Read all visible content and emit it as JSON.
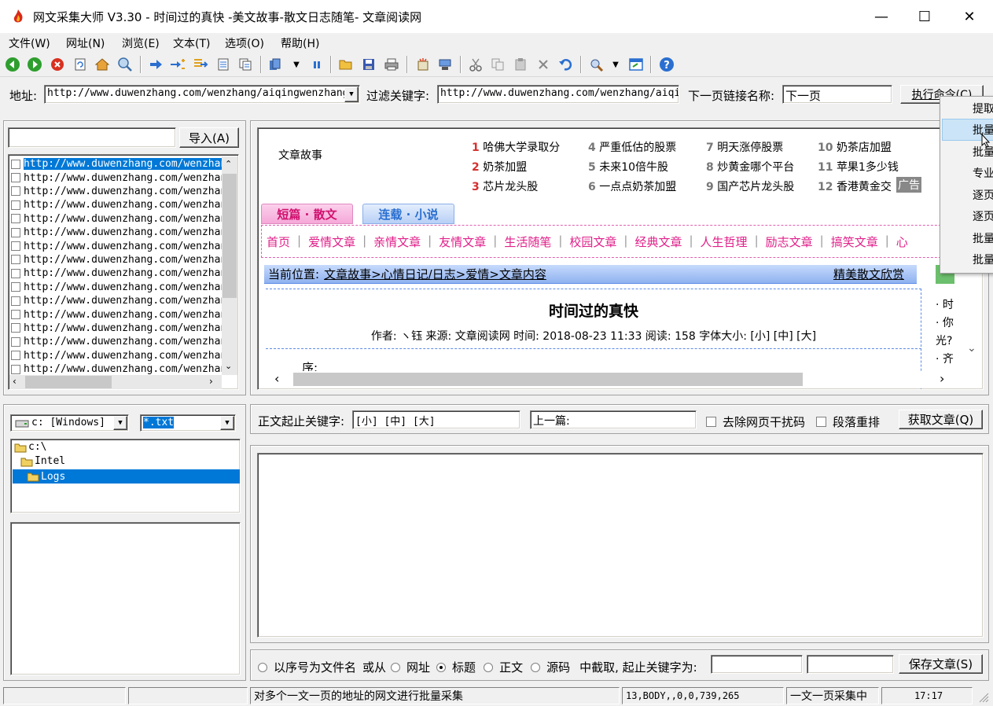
{
  "window": {
    "title": "网文采集大师 V3.30 - 时间过的真快 -美文故事-散文日志随笔- 文章阅读网",
    "minimize": "—",
    "maximize": "☐",
    "close": "✕"
  },
  "menu": [
    "文件(W)",
    "网址(N)",
    "浏览(E)",
    "文本(T)",
    "选项(O)",
    "帮助(H)"
  ],
  "address": {
    "label": "地址:",
    "value": "http://www.duwenzhang.com/wenzhang/aiqingwenzhang/",
    "filter_label": "过滤关键字:",
    "filter_value": "http://www.duwenzhang.com/wenzhang/aiqing",
    "next_label": "下一页链接名称:",
    "next_value": "下一页",
    "execute_button": "执行命令(C)"
  },
  "url_panel": {
    "import_button": "导入(A)",
    "search_value": "",
    "urls": [
      "http://www.duwenzhang.com/wenzhang",
      "http://www.duwenzhang.com/wenzhang",
      "http://www.duwenzhang.com/wenzhang",
      "http://www.duwenzhang.com/wenzhang",
      "http://www.duwenzhang.com/wenzhang",
      "http://www.duwenzhang.com/wenzhang",
      "http://www.duwenzhang.com/wenzhang",
      "http://www.duwenzhang.com/wenzhang",
      "http://www.duwenzhang.com/wenzhang",
      "http://www.duwenzhang.com/wenzhang",
      "http://www.duwenzhang.com/wenzhang",
      "http://www.duwenzhang.com/wenzhang",
      "http://www.duwenzhang.com/wenzhang",
      "http://www.duwenzhang.com/wenzhang",
      "http://www.duwenzhang.com/wenzhang",
      "http://www.duwenzhang.com/wenzhang"
    ]
  },
  "browser": {
    "site_label": "文章故事",
    "hot": [
      {
        "n": "1",
        "t": "哈佛大学录取分"
      },
      {
        "n": "2",
        "t": "奶茶加盟"
      },
      {
        "n": "3",
        "t": "芯片龙头股"
      },
      {
        "n": "4",
        "t": "严重低估的股票"
      },
      {
        "n": "5",
        "t": "未来10倍牛股"
      },
      {
        "n": "6",
        "t": "一点点奶茶加盟"
      },
      {
        "n": "7",
        "t": "明天涨停股票"
      },
      {
        "n": "8",
        "t": "炒黄金哪个平台"
      },
      {
        "n": "9",
        "t": "国产芯片龙头股"
      },
      {
        "n": "10",
        "t": "奶茶店加盟"
      },
      {
        "n": "11",
        "t": "苹果1多少钱"
      },
      {
        "n": "12",
        "t": "香港黄金交"
      }
    ],
    "ad": "广告",
    "tab1": "短篇 · 散文",
    "tab2": "连载 · 小说",
    "nav": [
      "首页",
      "|",
      "爱情文章",
      "|",
      "亲情文章",
      "|",
      "友情文章",
      "|",
      "生活随笔",
      "|",
      "校园文章",
      "|",
      "经典文章",
      "|",
      "人生哲理",
      "|",
      "励志文章",
      "|",
      "搞笑文章",
      "|",
      "心"
    ],
    "breadcrumb_prefix": "当前位置:",
    "breadcrumb": "文章故事>心情日记/日志>爱情>文章内容",
    "breadcrumb_right": "精美散文欣赏",
    "article_title": "时间过的真快",
    "meta": "作者: ヽ钰 来源: 文章阅读网 时间: 2018-08-23 11:33 阅读: 158 字体大小: [小] [中] [大]",
    "body_start": "序:",
    "side_items": [
      "· 时",
      "· 你",
      "光?",
      "· 齐"
    ]
  },
  "extract_row": {
    "start_label": "正文起止关键字:",
    "start_value": "[小] [中] [大]",
    "prev_value": "上一篇:",
    "remove_interference": "去除网页干扰码",
    "reorder_paragraphs": "段落重排",
    "fetch_button": "获取文章(Q)"
  },
  "drive": {
    "drive_value": "c: [Windows]",
    "filter_value": "*.txt",
    "tree": [
      "c:\\",
      "Intel",
      "Logs"
    ]
  },
  "save_row": {
    "opt_seq": "以序号为文件名",
    "or_from": "或从",
    "opt_url": "网址",
    "opt_title": "标题",
    "opt_body": "正文",
    "opt_source": "源码",
    "extract_label": "中截取, 起止关键字为:",
    "key1": "",
    "key2": "⁣",
    "save_button": "保存文章(S)"
  },
  "popup": [
    "提取",
    "批量",
    "批量",
    "专业",
    "逐页",
    "逐页",
    "批量",
    "批量"
  ],
  "status": {
    "s1": "",
    "s2": "",
    "message": "对多个一文一页的地址的网文进行批量采集",
    "coords": "13,BODY,,0,0,739,265",
    "mode": "一文一页采集中",
    "time": "17:17"
  },
  "colors": {
    "accent": "#0078d7",
    "rank_red": "#d3312f",
    "nav_pink": "#e0208a",
    "breadcrumb_blue": "#5b8be8"
  }
}
